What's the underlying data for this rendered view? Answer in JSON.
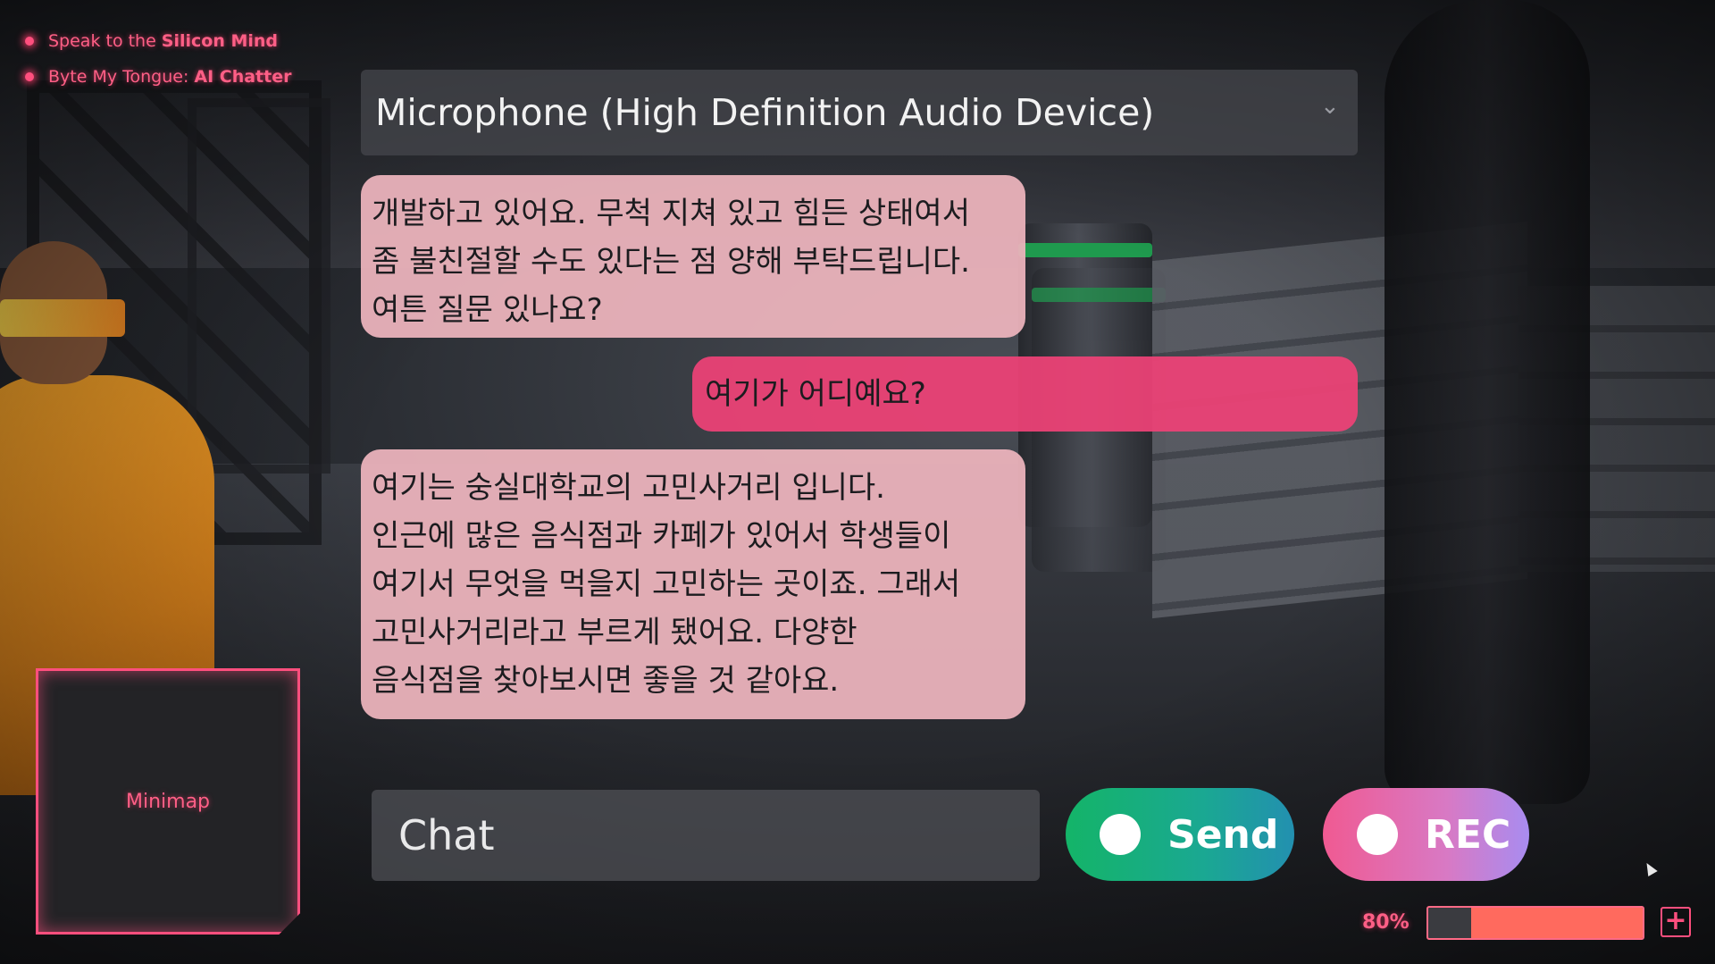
{
  "quests": [
    {
      "prefix": "Speak to the",
      "highlight": "Silicon Mind"
    },
    {
      "prefix": "Byte My Tongue:",
      "highlight": "AI Chatter"
    }
  ],
  "microphone": {
    "selected": "Microphone (High Definition Audio Device)"
  },
  "chat": {
    "messages": [
      {
        "role": "ai",
        "lines": [
          "개발하고 있어요. 무척 지쳐 있고 힘든 상태여서",
          "좀 불친절할 수도 있다는 점 양해 부탁드립니다.",
          "여튼 질문 있나요?"
        ]
      },
      {
        "role": "user",
        "text": "여기가 어디예요?"
      },
      {
        "role": "ai",
        "lines": [
          "여기는 숭실대학교의 고민사거리 입니다.",
          "인근에 많은 음식점과 카페가 있어서 학생들이",
          "여기서 무엇을 먹을지 고민하는 곳이죠. 그래서",
          "고민사거리라고 부르게 됐어요. 다양한",
          "음식점을 찾아보시면 좋을 것 같아요."
        ]
      }
    ],
    "input_placeholder": "Chat",
    "input_value": ""
  },
  "buttons": {
    "send_label": "Send",
    "rec_label": "REC"
  },
  "minimap": {
    "label": "Minimap"
  },
  "status": {
    "percent_label": "80%",
    "fraction": 0.8,
    "plus_symbol": "+"
  },
  "colors": {
    "accent": "#ff4f7e",
    "send": "#14b468",
    "user_bubble": "#ec4276",
    "ai_bubble": "#ecb4bc"
  }
}
